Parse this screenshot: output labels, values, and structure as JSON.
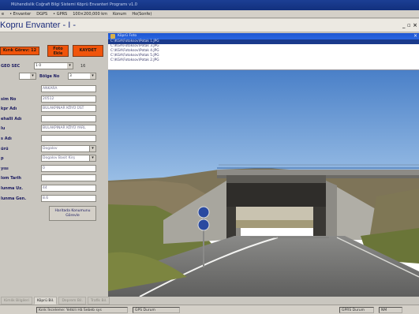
{
  "app": {
    "title": "Mühendislik Coğrafi Bilgi Sistemi Köprü Envanteri Programı v1.0"
  },
  "menu": [
    "e",
    "• Envanter",
    "DGPS",
    "• GPRS",
    "100×200,000 km",
    "Konum",
    "Ho(Sonfe)"
  ],
  "doc": {
    "title": "Kopru Envanter - I -",
    "controls": "_ ▫ ×"
  },
  "left": {
    "btn_count": "Kırık Görev: 12",
    "btn_photo": "Foto Ekle",
    "btn_save": "KAYDET",
    "gps_label": "GEO SEC",
    "gps_value": "1 0",
    "gps_num": "16",
    "sel_label": "Bölge No",
    "sel_value": "3",
    "fields": [
      {
        "label": "",
        "value": "ANKARA",
        "dd": false
      },
      {
        "label": "sim No",
        "value": "20512",
        "dd": false
      },
      {
        "label": "kpr Adı",
        "value": "BULAKPINAR KÖYÜ ÜST",
        "dd": false
      },
      {
        "label": "ehalli Adı",
        "value": "",
        "dd": false
      },
      {
        "label": "lu",
        "value": "BULAKPINAR KÖYÜ YARL",
        "dd": false
      },
      {
        "label": "s Adı",
        "value": "",
        "dd": false
      },
      {
        "label": "ürü",
        "value": "Dogalov",
        "dd": true
      },
      {
        "label": "p",
        "value": "Dogalov Basit Kirş",
        "dd": true
      },
      {
        "label": "yısı",
        "value": "0",
        "dd": false
      },
      {
        "label": "lom Tarih",
        "value": "",
        "dd": false
      },
      {
        "label": "lunma Uz.",
        "value": "44",
        "dd": false
      },
      {
        "label": "lunma Gen.",
        "value": "8.6",
        "dd": false
      }
    ],
    "action_btn": "Haritada Konumunu Görevle"
  },
  "viewer": {
    "title": "Köprü Foto",
    "close": "×",
    "files": [
      "C:\\KGA\\Fotoksov\\Potak 1.JPG",
      "C:\\KGA\\Fotoksov\\Potak 3.JPG",
      "C:\\KGA\\Fotoksov\\Potak 4.JPG",
      "C:\\KGA\\Fotoksov\\Potak 5.JPG",
      "C:\\KGA\\Fotoksov\\Potak 2.JPG"
    ],
    "selected_index": 0
  },
  "tabs": [
    "Kimlik Bilgileri",
    "Köprü Bil.",
    "Deprem Bil.",
    "Trafik Bil."
  ],
  "active_tab": 1,
  "status": {
    "user": "Kırık İnceleme: Yetkili Hâ Sebeb sys",
    "module": "GPS Durum",
    "conn": "GPRS Durum",
    "mode": "NM"
  },
  "colors": {
    "accent_red": "#f0540b",
    "title_blue": "#12307d",
    "sky": "#5b8fd1"
  }
}
